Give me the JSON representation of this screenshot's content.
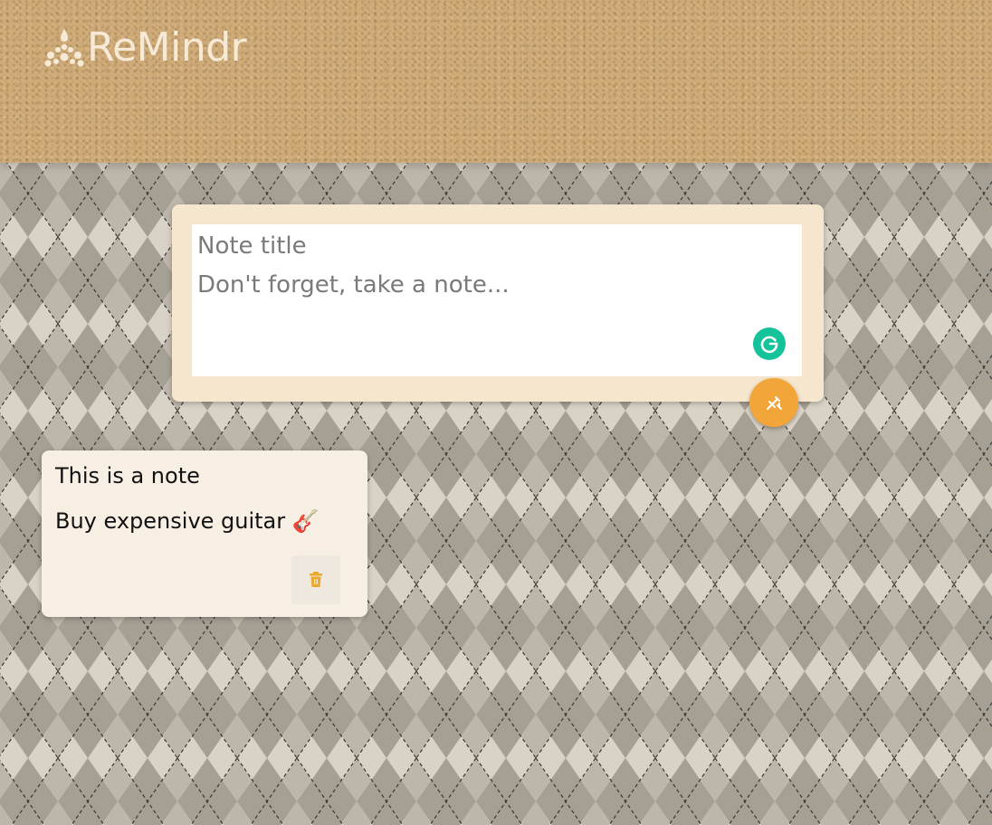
{
  "app": {
    "name": "ReMindr",
    "logo_icon": "flower-icon"
  },
  "composer": {
    "title_placeholder": "Note title",
    "body_placeholder": "Don't forget, take a note...",
    "add_icon": "add-note-icon",
    "grammarly_icon": "grammarly-icon"
  },
  "notes": [
    {
      "title": "This is a note",
      "body": "Buy expensive guitar 🎸",
      "delete_icon": "trash-icon"
    }
  ],
  "colors": {
    "header": "#d1ad7a",
    "composer_bg": "#f6e6cd",
    "accent": "#f2a63a",
    "note_bg": "#f8efe4",
    "grammarly": "#15c39a",
    "pattern_light": "#d9d2c6",
    "pattern_dark": "#a59f94"
  }
}
